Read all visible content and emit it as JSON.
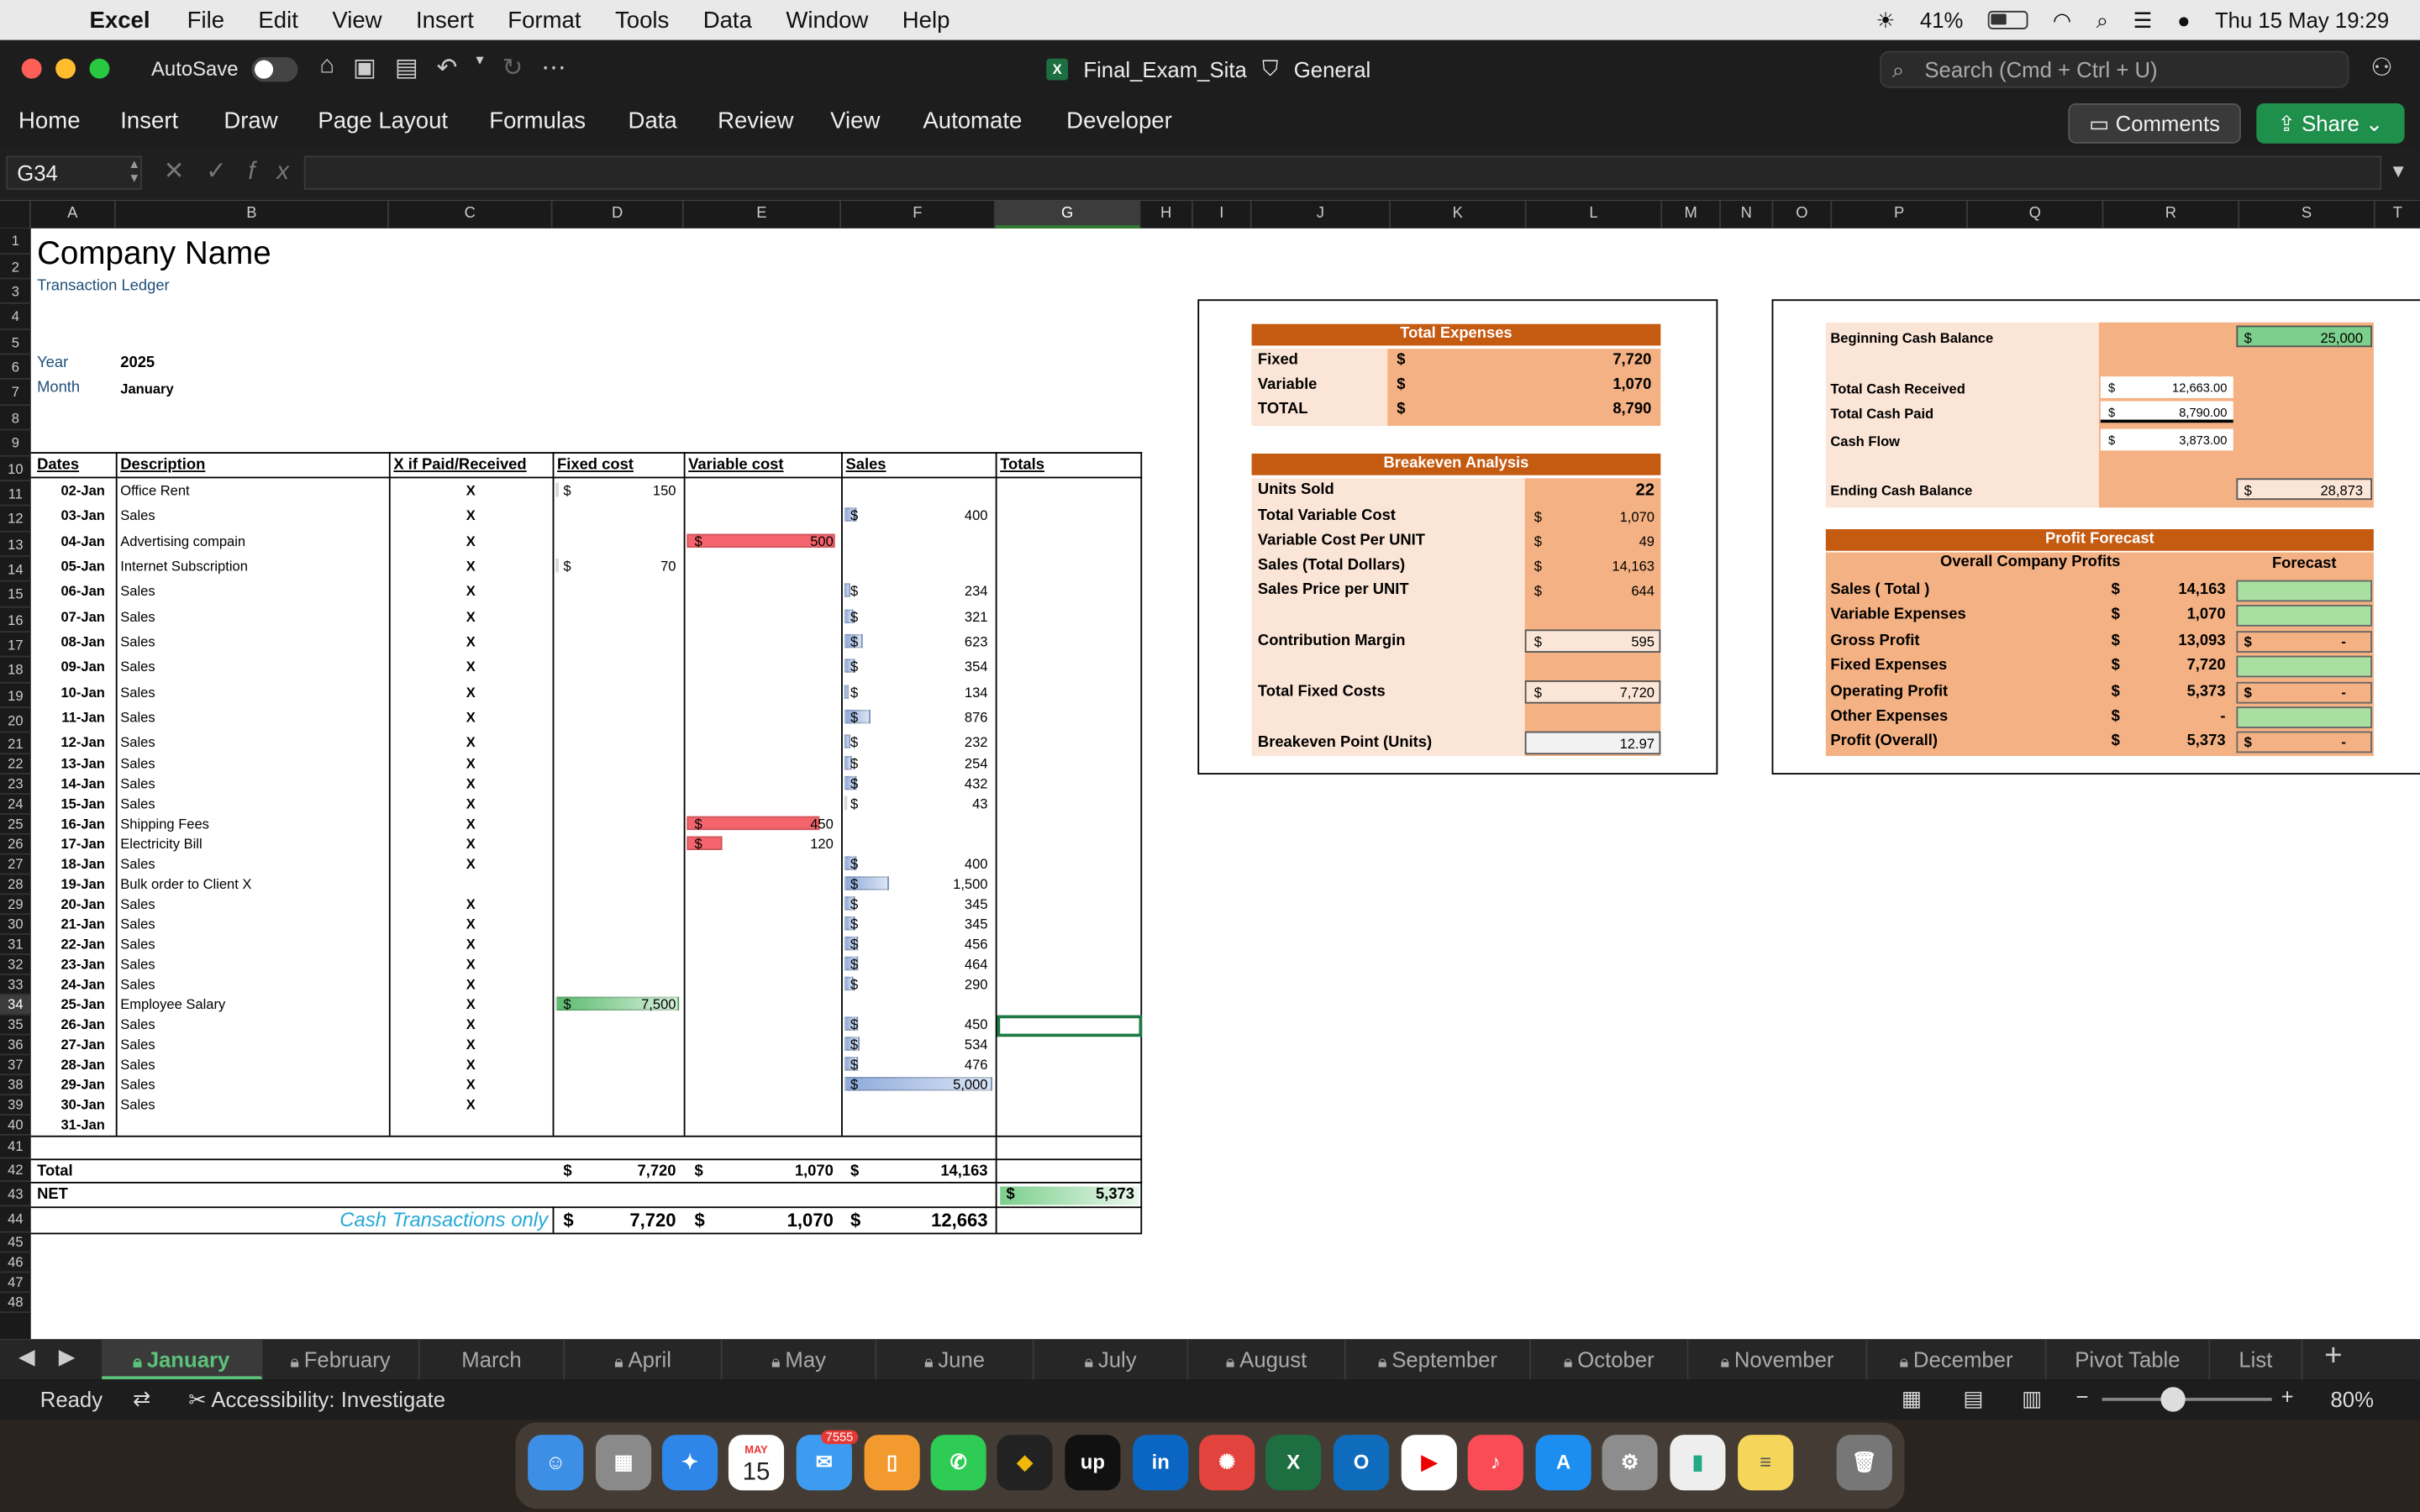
{
  "menubar": {
    "app": "Excel",
    "items": [
      "File",
      "Edit",
      "View",
      "Insert",
      "Format",
      "Tools",
      "Data",
      "Window",
      "Help"
    ],
    "battery": "41%",
    "clock": "Thu 15 May  19:29"
  },
  "titlebar": {
    "autosave": "AutoSave",
    "doc": "Final_Exam_Sita",
    "sensitivity": "General",
    "search_placeholder": "Search (Cmd + Ctrl + U)"
  },
  "ribbon": {
    "tabs": [
      "Home",
      "Insert",
      "Draw",
      "Page Layout",
      "Formulas",
      "Data",
      "Review",
      "View",
      "Automate",
      "Developer"
    ],
    "comments": "Comments",
    "share": "Share"
  },
  "formula": {
    "cell": "G34",
    "fx": "fx",
    "value": ""
  },
  "columns": [
    "A",
    "B",
    "C",
    "D",
    "E",
    "F",
    "G",
    "H",
    "I",
    "J",
    "K",
    "L",
    "M",
    "N",
    "O",
    "P",
    "Q",
    "R",
    "S",
    "T"
  ],
  "sheet": {
    "company": "Company Name",
    "subtitle": "Transaction Ledger",
    "year_label": "Year",
    "year": "2025",
    "month_label": "Month",
    "month": "January",
    "headers": [
      "Dates",
      "Description",
      "X if Paid/Received",
      "Fixed cost",
      "Variable cost",
      "Sales",
      "Totals"
    ],
    "rows": [
      [
        "02-Jan",
        "Office Rent",
        "X",
        "150",
        "",
        ""
      ],
      [
        "03-Jan",
        "Sales",
        "X",
        "",
        "",
        "400"
      ],
      [
        "04-Jan",
        "Advertising compain",
        "X",
        "",
        "500",
        ""
      ],
      [
        "05-Jan",
        "Internet Subscription",
        "X",
        "70",
        "",
        ""
      ],
      [
        "06-Jan",
        "Sales",
        "X",
        "",
        "",
        "234"
      ],
      [
        "07-Jan",
        "Sales",
        "X",
        "",
        "",
        "321"
      ],
      [
        "08-Jan",
        "Sales",
        "X",
        "",
        "",
        "623"
      ],
      [
        "09-Jan",
        "Sales",
        "X",
        "",
        "",
        "354"
      ],
      [
        "10-Jan",
        "Sales",
        "X",
        "",
        "",
        "134"
      ],
      [
        "11-Jan",
        "Sales",
        "X",
        "",
        "",
        "876"
      ],
      [
        "12-Jan",
        "Sales",
        "X",
        "",
        "",
        "232"
      ],
      [
        "13-Jan",
        "Sales",
        "X",
        "",
        "",
        "254"
      ],
      [
        "14-Jan",
        "Sales",
        "X",
        "",
        "",
        "432"
      ],
      [
        "15-Jan",
        "Sales",
        "X",
        "",
        "",
        "43"
      ],
      [
        "16-Jan",
        "Shipping Fees",
        "X",
        "",
        "450",
        ""
      ],
      [
        "17-Jan",
        "Electricity Bill",
        "X",
        "",
        "120",
        ""
      ],
      [
        "18-Jan",
        "Sales",
        "X",
        "",
        "",
        "400"
      ],
      [
        "19-Jan",
        "Bulk order to Client X",
        "",
        "",
        "",
        "1,500"
      ],
      [
        "20-Jan",
        "Sales",
        "X",
        "",
        "",
        "345"
      ],
      [
        "21-Jan",
        "Sales",
        "X",
        "",
        "",
        "345"
      ],
      [
        "22-Jan",
        "Sales",
        "X",
        "",
        "",
        "456"
      ],
      [
        "23-Jan",
        "Sales",
        "X",
        "",
        "",
        "464"
      ],
      [
        "24-Jan",
        "Sales",
        "X",
        "",
        "",
        "290"
      ],
      [
        "25-Jan",
        "Employee Salary",
        "X",
        "7,500",
        "",
        ""
      ],
      [
        "26-Jan",
        "Sales",
        "X",
        "",
        "",
        "450"
      ],
      [
        "27-Jan",
        "Sales",
        "X",
        "",
        "",
        "534"
      ],
      [
        "28-Jan",
        "Sales",
        "X",
        "",
        "",
        "476"
      ],
      [
        "29-Jan",
        "Sales",
        "X",
        "",
        "",
        "5,000"
      ],
      [
        "30-Jan",
        "Sales",
        "X",
        "",
        "",
        ""
      ],
      [
        "31-Jan",
        "",
        "",
        "",
        "",
        ""
      ]
    ],
    "total_label": "Total",
    "total_fixed": "7,720",
    "total_variable": "1,070",
    "total_sales": "14,163",
    "net_label": "NET",
    "net": "5,373",
    "cash_label": "Cash Transactions only",
    "cash_fixed": "7,720",
    "cash_variable": "1,070",
    "cash_sales": "12,663",
    "dollar": "$"
  },
  "expenses": {
    "title": "Total Expenses",
    "rows": [
      [
        "Fixed",
        "7,720"
      ],
      [
        "Variable",
        "1,070"
      ],
      [
        "TOTAL",
        "8,790"
      ]
    ]
  },
  "breakeven": {
    "title": "Breakeven Analysis",
    "units_label": "Units Sold",
    "units": "22",
    "rows": [
      [
        "Total Variable Cost",
        "1,070"
      ],
      [
        "Variable Cost Per UNIT",
        "49"
      ],
      [
        "Sales  (Total Dollars)",
        "14,163"
      ],
      [
        "Sales Price per UNIT",
        "644"
      ]
    ],
    "cm_label": "Contribution Margin",
    "cm": "595",
    "tfc_label": "Total Fixed Costs",
    "tfc": "7,720",
    "bep_label": "Breakeven Point (Units)",
    "bep": "12.97"
  },
  "cash": {
    "begin_label": "Beginning Cash Balance",
    "begin": "25,000",
    "received_label": "Total Cash Received",
    "received": "12,663.00",
    "paid_label": "Total Cash Paid",
    "paid": "8,790.00",
    "flow_label": "Cash Flow",
    "flow": "3,873.00",
    "end_label": "Ending Cash Balance",
    "end": "28,873"
  },
  "forecast": {
    "title": "Profit Forecast",
    "overall": "Overall Company Profits",
    "forecast_hdr": "Forecast",
    "rows": [
      [
        "Sales ( Total )",
        "14,163",
        ""
      ],
      [
        "Variable Expenses",
        "1,070",
        ""
      ],
      [
        "Gross Profit",
        "13,093",
        "-"
      ],
      [
        "Fixed Expenses",
        "7,720",
        ""
      ],
      [
        "Operating Profit",
        "5,373",
        "-"
      ],
      [
        "Other Expenses",
        "-",
        ""
      ],
      [
        "Profit (Overall)",
        "5,373",
        "-"
      ]
    ]
  },
  "sheettabs": [
    "January",
    "February",
    "March",
    "April",
    "May",
    "June",
    "July",
    "August",
    "September",
    "October",
    "November",
    "December",
    "Pivot Table",
    "List"
  ],
  "status": {
    "ready": "Ready",
    "accessibility": "Accessibility: Investigate",
    "zoom": "80%"
  },
  "dock": {
    "calendar_month": "MAY",
    "calendar_day": "15",
    "mail_badge": "7555"
  },
  "colors": {
    "accent_green": "#1f8f4c",
    "header_orange": "#c55a11",
    "light_orange": "#f4b183",
    "pale_orange": "#fbe5d6",
    "red_bar": "#f4646c",
    "blue_bar": "#8eaadb",
    "green_bar": "#7ccf8c"
  }
}
